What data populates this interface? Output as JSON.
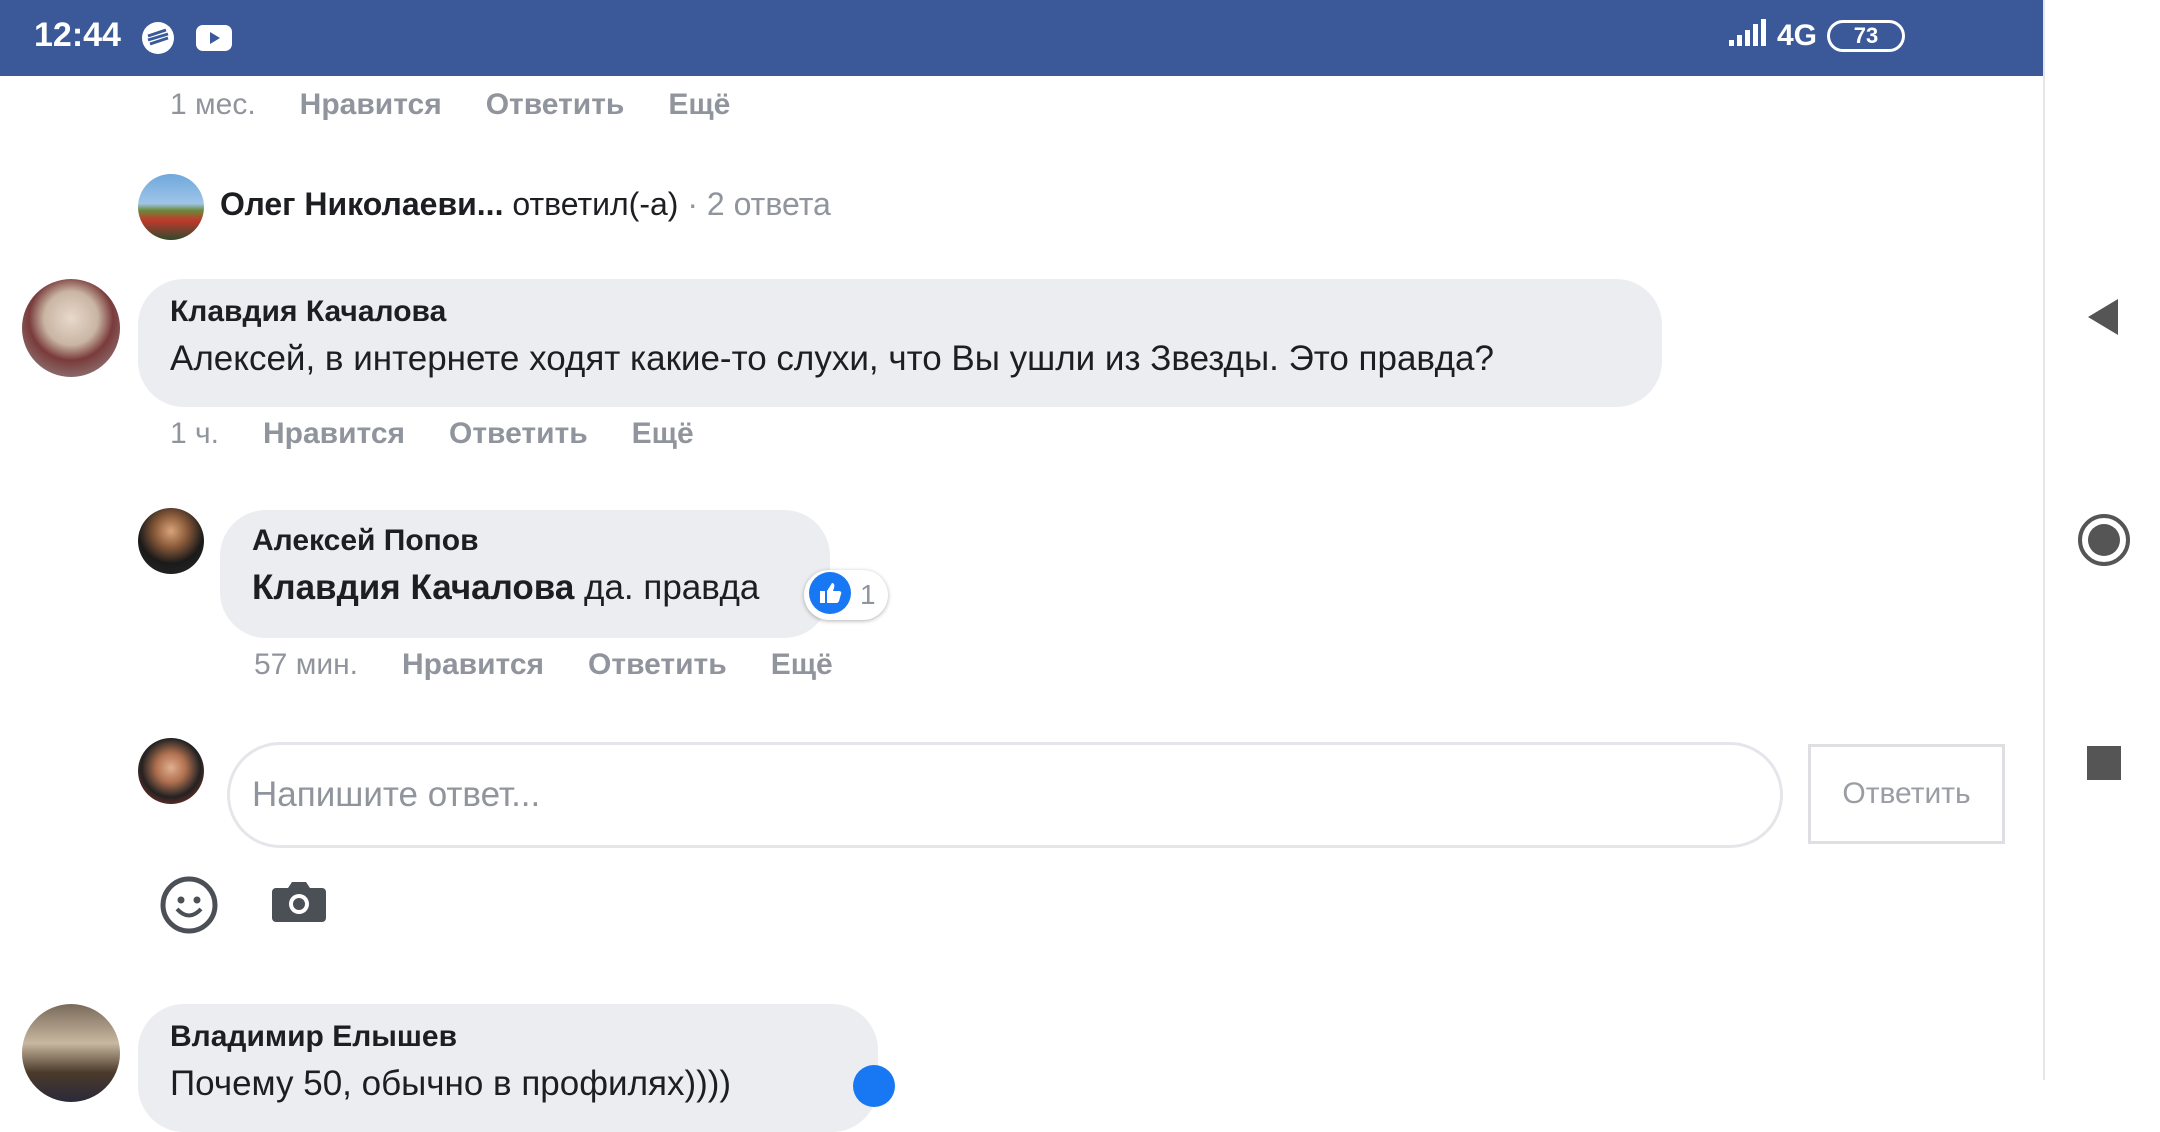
{
  "status_bar": {
    "time": "12:44",
    "network": "4G",
    "battery": "73",
    "icons": [
      "sberbank-icon",
      "youtube-icon",
      "signal-icon",
      "battery-icon"
    ]
  },
  "nav": {
    "icons": [
      "back-icon",
      "home-icon",
      "recents-icon"
    ]
  },
  "top_meta": {
    "time": "1 мес.",
    "like": "Нравится",
    "reply": "Ответить",
    "more": "Ещё"
  },
  "reply_summary": {
    "name": "Олег Николаеви...",
    "action": "ответил(-а)",
    "count": "· 2 ответа"
  },
  "comment1": {
    "author": "Клавдия Качалова",
    "text": "Алексей, в интернете ходят какие-то слухи, что Вы ушли из Звезды. Это правда?",
    "meta": {
      "time": "1 ч.",
      "like": "Нравится",
      "reply": "Ответить",
      "more": "Ещё"
    }
  },
  "reply1": {
    "author": "Алексей Попов",
    "mention": "Клавдия Качалова",
    "text": "да. правда",
    "reactions": "1",
    "meta": {
      "time": "57 мин.",
      "like": "Нравится",
      "reply": "Ответить",
      "more": "Ещё"
    }
  },
  "composer": {
    "placeholder": "Напишите ответ...",
    "submit_label": "Ответить",
    "icons": [
      "emoji-icon",
      "camera-icon"
    ]
  },
  "comment2": {
    "author": "Владимир Елышев",
    "text": "Почему 50, обычно в профилях))))"
  },
  "colors": {
    "header": "#3b5998",
    "bubble": "#ebedf0",
    "meta": "#90949c",
    "like_blue": "#1877f2"
  }
}
